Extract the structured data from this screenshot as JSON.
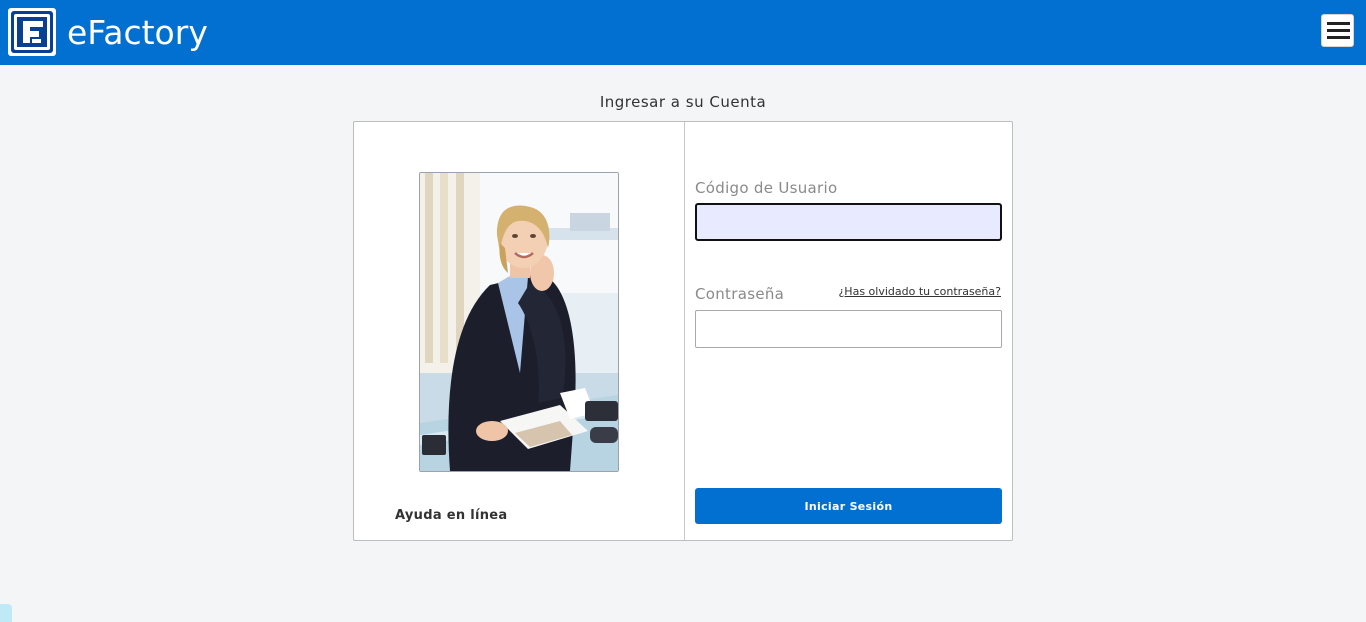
{
  "header": {
    "app_title": "eFactory",
    "logo_icon": "efactory-logo-icon",
    "menu_icon": "hamburger-menu-icon",
    "brand_color": "#0270d0"
  },
  "login": {
    "heading": "Ingresar a su Cuenta",
    "photo": "woman-at-desk-photo",
    "help_link": "Ayuda en línea",
    "username_label": "Código de Usuario",
    "username_value": "",
    "password_label": "Contraseña",
    "password_value": "",
    "forgot_password_link": "¿Has olvidado tu contraseña?",
    "submit_label": "Iniciar Sesión"
  }
}
